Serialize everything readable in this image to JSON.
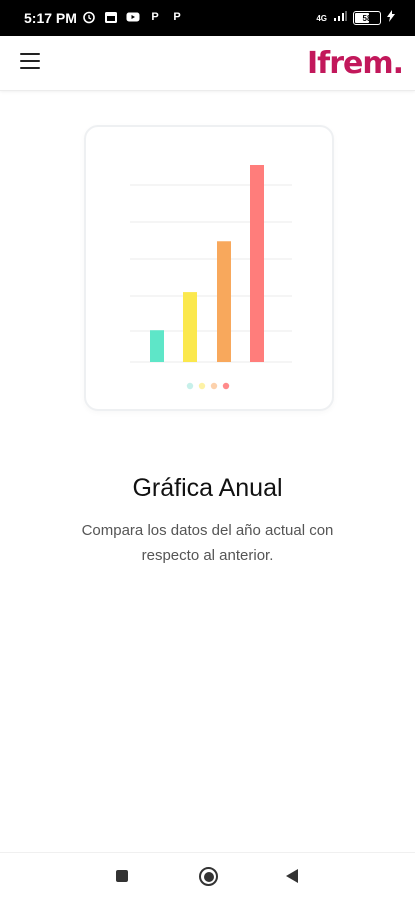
{
  "status_bar": {
    "time": "5:17 PM",
    "left_icons": [
      "alarm-icon",
      "calendar-icon",
      "youtube-icon",
      "p-app-icon",
      "p-app-icon"
    ],
    "p_label": "P",
    "network": "4G",
    "battery": "58"
  },
  "header": {
    "logo_text": "Ifrem.",
    "brand_color": "#c2185b",
    "menu_icon": "hamburger-menu-icon"
  },
  "illustration": {
    "bars": [
      {
        "value": 1,
        "color": "#5ee6c8"
      },
      {
        "value": 2.2,
        "color": "#fbe84d"
      },
      {
        "value": 3.8,
        "color": "#f8a85c"
      },
      {
        "value": 6.2,
        "color": "#ff7d7b"
      }
    ],
    "dot_colors": [
      "#c7f0ea",
      "#fdf2a6",
      "#fcd1ac",
      "#ff8a8a"
    ]
  },
  "content": {
    "title": "Gráfica Anual",
    "description": "Compara los datos del año actual con respecto al anterior."
  },
  "nav": {
    "recents_icon": "square-icon",
    "home_icon": "circle-icon",
    "back_icon": "back-triangle-icon"
  }
}
